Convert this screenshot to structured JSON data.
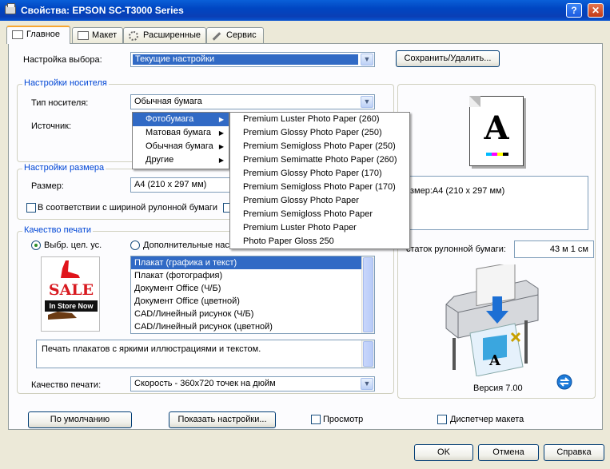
{
  "window": {
    "title": "Свойства: EPSON SC-T3000 Series",
    "help_btn": "?",
    "close_btn": "✕"
  },
  "tabs": [
    {
      "label": "Главное",
      "active": true
    },
    {
      "label": "Макет"
    },
    {
      "label": "Расширенные"
    },
    {
      "label": "Сервис"
    }
  ],
  "main": {
    "preset_label": "Настройка выбора:",
    "preset_value": "Текущие настройки",
    "save_delete_btn": "Сохранить/Удалить...",
    "media_group": "Настройки носителя",
    "media_type_label": "Тип носителя:",
    "media_type_value": "Обычная бумага",
    "source_label": "Источник:",
    "size_group": "Настройки размера",
    "size_label": "Размер:",
    "size_value": "A4 (210 x 297 мм)",
    "roll_width_label": "В соответствии с шириной рулонной бумаги",
    "quality_group": "Качество печати",
    "radio_target_label": "Выбр. цел. ус.",
    "radio_advanced_label": "Дополнительные нас",
    "target_list": [
      "Плакат (графика и текст)",
      "Плакат (фотография)",
      "Документ Office (Ч/Б)",
      "Документ Office (цветной)",
      "CAD/Линейный рисунок (Ч/Б)",
      "CAD/Линейный рисунок (цветной)"
    ],
    "description": "Печать плакатов с яркими иллюстрациями и текстом.",
    "quality_label": "Качество печати:",
    "quality_value": "Скорость - 360x720 точек на дюйм",
    "sale_text": "SALE",
    "sale_sub": "In Store Now"
  },
  "media_menu": [
    {
      "label": "Фотобумага",
      "highlighted": true
    },
    {
      "label": "Матовая бумага"
    },
    {
      "label": "Обычная бумага"
    },
    {
      "label": "Другие"
    }
  ],
  "photo_submenu": [
    "Premium Luster Photo Paper (260)",
    "Premium Glossy Photo Paper (250)",
    "Premium Semigloss Photo Paper (250)",
    "Premium Semimatte Photo Paper (260)",
    "Premium Glossy Photo Paper (170)",
    "Premium Semigloss Photo Paper (170)",
    "Premium Glossy Photo Paper",
    "Premium Semigloss Photo Paper",
    "Premium Luster Photo Paper",
    "Photo Paper Gloss 250"
  ],
  "preview": {
    "paper_letter": "A",
    "size_info": "змер:A4 (210 x 297 мм)",
    "roll_remaining_label": "статок рулонной бумаги:",
    "roll_remaining_value": "43 м 1 см",
    "version": "Версия 7.00"
  },
  "bottom": {
    "defaults_btn": "По умолчанию",
    "show_settings_btn": "Показать настройки...",
    "preview_label": "Просмотр",
    "layout_manager_label": "Диспетчер макета"
  },
  "footer": {
    "ok": "OK",
    "cancel": "Отмена",
    "help": "Справка"
  }
}
